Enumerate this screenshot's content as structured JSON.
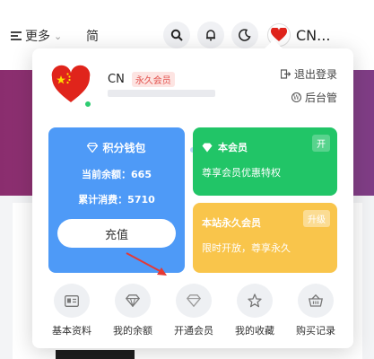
{
  "topbar": {
    "menu_label": "更多",
    "lang_label": "简",
    "user_name": "CN...",
    "icons": [
      "search-icon",
      "bell-icon",
      "moon-icon",
      "heart-avatar-icon"
    ]
  },
  "popup": {
    "username": "CN",
    "vip_tag": "永久会员",
    "logout_label": "退出登录",
    "admin_label": "后台管",
    "wallet": {
      "title": "积分钱包",
      "balance_line": "当前余额：665",
      "spent_line": "累计消费：5710",
      "recharge_label": "充值"
    },
    "vip_member": {
      "title": "本会员",
      "desc": "尊享会员优惠特权",
      "badge": "开"
    },
    "vip_forever": {
      "title": "本站永久会员",
      "desc": "限时开放，尊享永久",
      "badge": "升级"
    },
    "nav": [
      {
        "label": "基本资料",
        "icon": "profile-card-icon"
      },
      {
        "label": "我的余额",
        "icon": "diamond-icon"
      },
      {
        "label": "开通会员",
        "icon": "vip-diamond-icon"
      },
      {
        "label": "我的收藏",
        "icon": "star-icon"
      },
      {
        "label": "购买记录",
        "icon": "basket-icon"
      }
    ]
  },
  "colors": {
    "wallet_blue": "#4e9af7",
    "vip_green": "#21c567",
    "vip_yellow": "#f9c54b",
    "banner_purple": "#8a2d6e",
    "arrow_red": "#e53935"
  }
}
